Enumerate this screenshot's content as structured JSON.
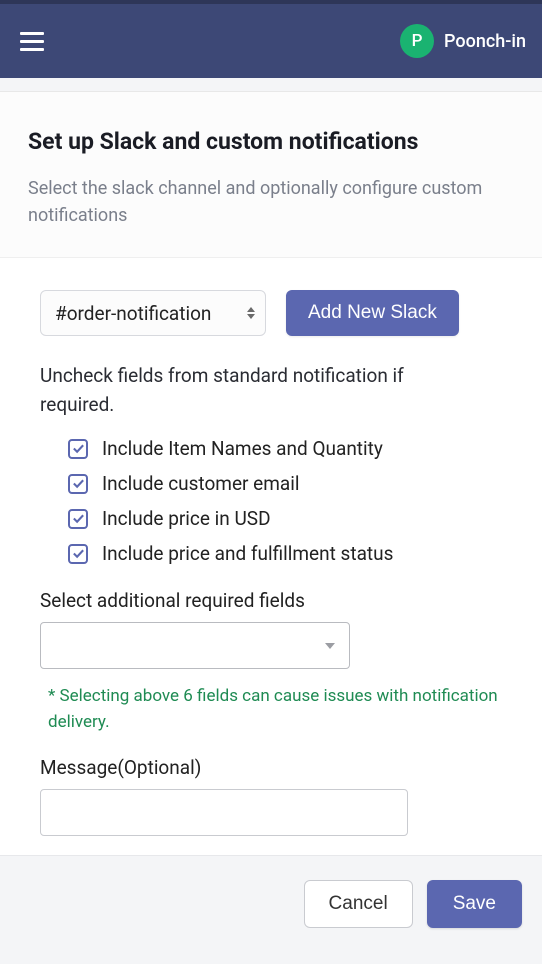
{
  "header": {
    "avatar_initial": "P",
    "user_label": "Poonch-in"
  },
  "page": {
    "title": "Set up Slack and custom notifications",
    "subtitle": "Select the slack channel and optionally configure custom notifications"
  },
  "form": {
    "channel_selected": "#order-notification",
    "add_slack_label": "Add New Slack",
    "uncheck_instruction": "Uncheck fields from standard notification if required.",
    "checks": [
      {
        "label": "Include Item Names and Quantity",
        "checked": true
      },
      {
        "label": "Include customer email",
        "checked": true
      },
      {
        "label": "Include price in USD",
        "checked": true
      },
      {
        "label": "Include price and fulfillment status",
        "checked": true
      }
    ],
    "additional_label": "Select additional required fields",
    "additional_value": "",
    "hint": "* Selecting above 6 fields can cause issues with notification delivery.",
    "message_label": "Message(Optional)",
    "message_value": ""
  },
  "footer": {
    "cancel": "Cancel",
    "save": "Save"
  }
}
